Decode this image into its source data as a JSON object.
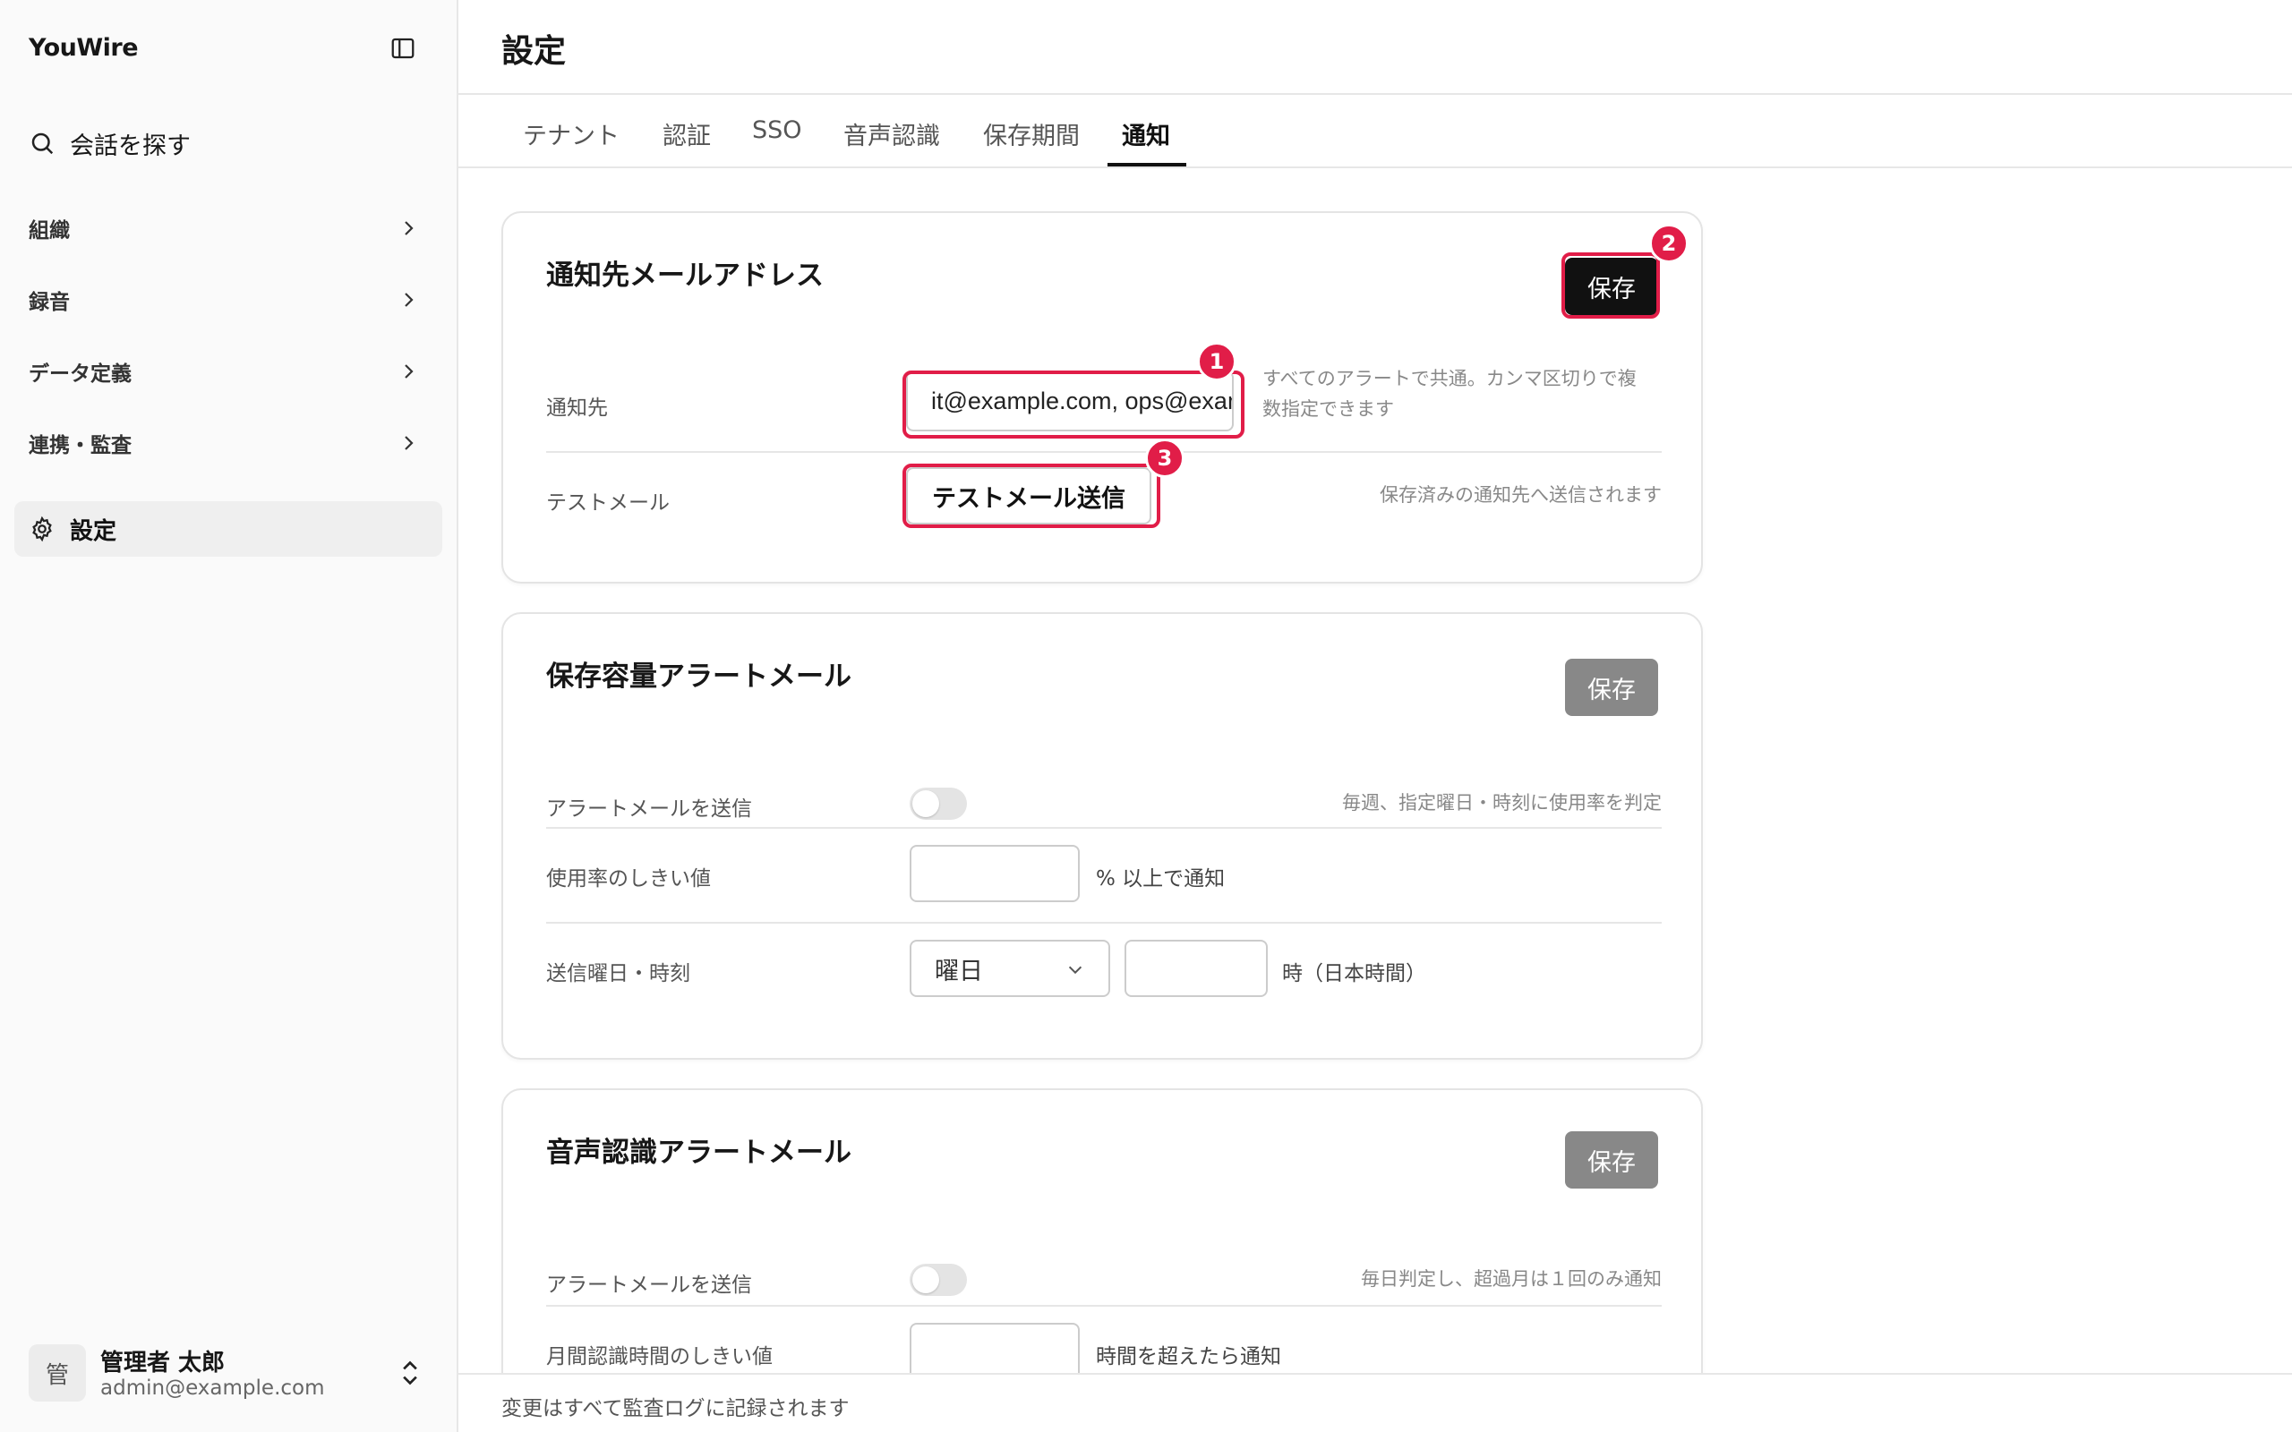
{
  "app": {
    "name": "YouWire"
  },
  "sidebar": {
    "search_label": "会話を探す",
    "items": [
      {
        "label": "組織"
      },
      {
        "label": "録音"
      },
      {
        "label": "データ定義"
      },
      {
        "label": "連携・監査"
      }
    ],
    "active_item": "設定"
  },
  "user": {
    "avatar_initial": "管",
    "name": "管理者 太郎",
    "email": "admin@example.com"
  },
  "page": {
    "title": "設定"
  },
  "tabs": [
    {
      "label": "テナント"
    },
    {
      "label": "認証"
    },
    {
      "label": "SSO"
    },
    {
      "label": "音声認識"
    },
    {
      "label": "保存期間"
    },
    {
      "label": "通知",
      "active": true
    }
  ],
  "notify_card": {
    "title": "通知先メールアドレス",
    "save_label": "保存",
    "recipient_label": "通知先",
    "recipient_value": "it@example.com, ops@example.com",
    "recipient_hint_1": "すべてのアラートで共通。カンマ区切りで複",
    "recipient_hint_2": "数指定できます",
    "test_label": "テストメール",
    "test_button": "テストメール送信",
    "test_hint": "保存済みの通知先へ送信されます"
  },
  "storage_card": {
    "title": "保存容量アラートメール",
    "save_label": "保存",
    "send_label": "アラートメールを送信",
    "send_hint": "毎週、指定曜日・時刻に使用率を判定",
    "threshold_label": "使用率のしきい値",
    "threshold_suffix": "% 以上で通知",
    "schedule_label": "送信曜日・時刻",
    "weekday_selected": "曜日",
    "hour_suffix": "時（日本時間）"
  },
  "asr_card": {
    "title": "音声認識アラートメール",
    "save_label": "保存",
    "send_label": "アラートメールを送信",
    "send_hint": "毎日判定し、超過月は１回のみ通知",
    "threshold_label": "月間認識時間のしきい値",
    "threshold_suffix": "時間を超えたら通知"
  },
  "annotations": [
    "1",
    "2",
    "3"
  ],
  "footer": {
    "text": "変更はすべて監査ログに記録されます"
  },
  "colors": {
    "highlight": "#e11d48",
    "primary": "#111111",
    "disabled": "#888888"
  }
}
